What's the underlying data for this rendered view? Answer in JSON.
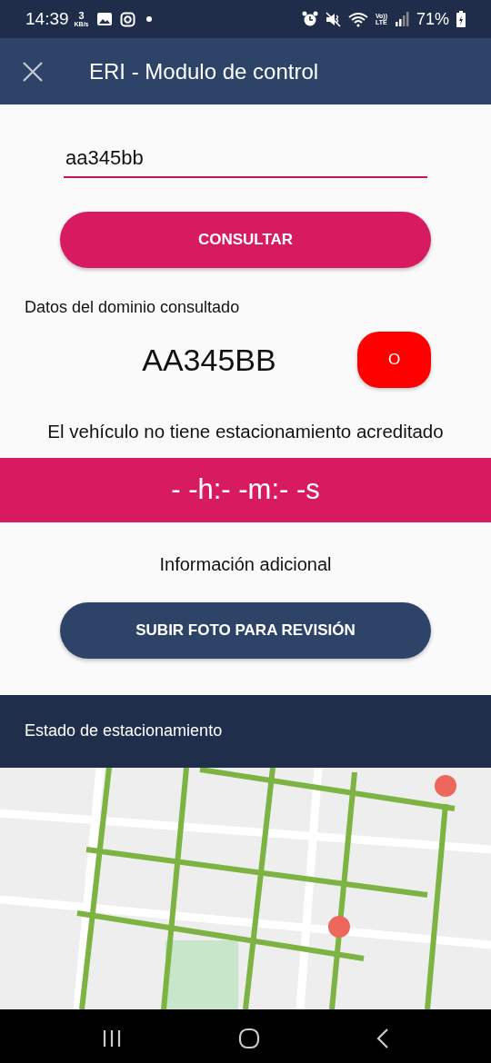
{
  "status_bar": {
    "time": "14:39",
    "speed_value": "3",
    "speed_unit": "KB/s",
    "network": "Vo))\nLTE",
    "battery": "71%"
  },
  "toolbar": {
    "title": "ERI - Modulo de control"
  },
  "search": {
    "value": "aa345bb"
  },
  "consult_button": "CONSULTAR",
  "domain_label": "Datos del dominio consultado",
  "plate": "AA345BB",
  "status_button": {
    "label": "O",
    "color": "#ff0000"
  },
  "message": "El vehículo no tiene estacionamiento acreditado",
  "timer": "- -h:- -m:- -s",
  "extra_label": "Información adicional",
  "upload_button": "SUBIR FOTO PARA REVISIÓN",
  "section_title": "Estado de estacionamiento"
}
